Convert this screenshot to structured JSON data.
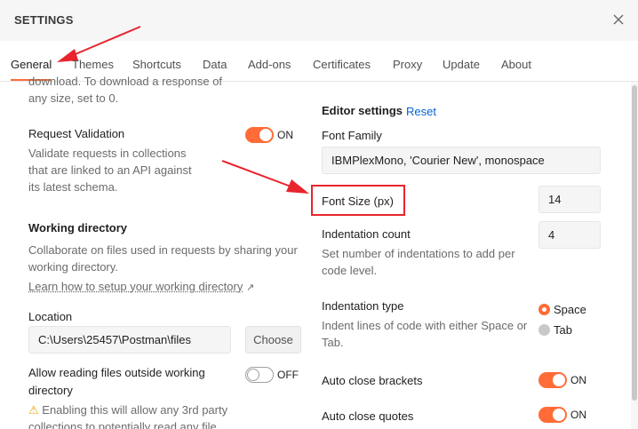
{
  "header": {
    "title": "SETTINGS"
  },
  "tabs": [
    "General",
    "Themes",
    "Shortcuts",
    "Data",
    "Add-ons",
    "Certificates",
    "Proxy",
    "Update",
    "About"
  ],
  "left": {
    "cut_text_line1": "download. To download a response of",
    "cut_text_line2": "any size, set to 0.",
    "request_validation": {
      "label": "Request Validation",
      "desc_line1": "Validate requests in collections",
      "desc_line2": "that are linked to an API against",
      "desc_line3": "its latest schema.",
      "toggle": "ON"
    },
    "working_directory": {
      "heading": "Working directory",
      "desc_line1": "Collaborate on files used in requests by sharing your",
      "desc_line2": "working directory.",
      "link": "Learn how to setup your working directory",
      "link_arrow": "↗"
    },
    "location": {
      "label": "Location",
      "value": "C:\\Users\\25457\\Postman\\files",
      "button": "Choose"
    },
    "allow_outside": {
      "label_line1": "Allow reading files outside working",
      "label_line2": "directory",
      "toggle": "OFF",
      "warning_icon": "⚠",
      "warning_line1": "Enabling this will allow any 3rd party",
      "warning_line2": "collections to potentially read any file"
    }
  },
  "right": {
    "editor_settings": "Editor settings",
    "reset": "Reset",
    "font_family": {
      "label": "Font Family",
      "value": "IBMPlexMono, 'Courier New', monospace"
    },
    "font_size": {
      "label": "Font Size (px)",
      "value": "14"
    },
    "indentation_count": {
      "label": "Indentation count",
      "desc_line1": "Set number of indentations to add per",
      "desc_line2": "code level.",
      "value": "4"
    },
    "indentation_type": {
      "label": "Indentation type",
      "desc_line1": "Indent lines of code with either Space or",
      "desc_line2": "Tab.",
      "option_space": "Space",
      "option_tab": "Tab"
    },
    "auto_close_brackets": {
      "label": "Auto close brackets",
      "toggle": "ON"
    },
    "auto_close_quotes": {
      "label": "Auto close quotes",
      "toggle": "ON"
    }
  },
  "colors": {
    "accent": "#ff6c37",
    "annotation": "#e8242e",
    "link": "#0265d2"
  },
  "icons": {
    "close": "close-icon",
    "warning": "warning-icon",
    "external_link": "external-link-icon"
  }
}
